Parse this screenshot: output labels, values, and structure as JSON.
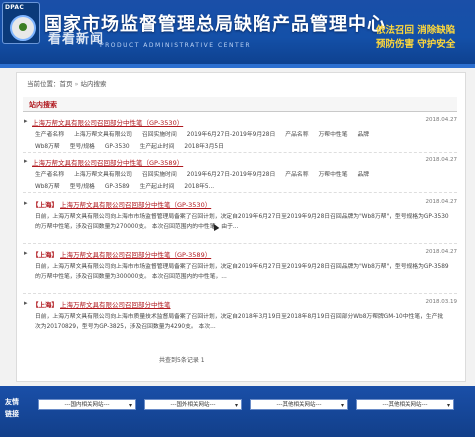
{
  "header": {
    "logo_text": "DPAC",
    "title_cn": "国家市场监督管理总局缺陷产品管理中心",
    "watermark": "看看新闻",
    "title_en": "PRODUCT ADMINISTRATIVE CENTER",
    "slogan_line1": "依法召回 消除缺陷",
    "slogan_line2": "预防伤害 守护安全"
  },
  "breadcrumb": {
    "prefix": "当前位置：",
    "home": "首页",
    "sep": "»",
    "current": "站内搜索"
  },
  "section": {
    "title": "站内搜索"
  },
  "results": [
    {
      "title": "上海万帮文具有限公司召回部分中性笔（GP-3530）",
      "date": "2018.04.27",
      "rows": [
        [
          "生产者名称",
          "上海万帮文具有限公司",
          "召回实施时间",
          "2019年6月27日-2019年9月28日",
          "产品名称",
          "万帮中性笔",
          "品牌"
        ],
        [
          "Wb8万帮",
          "型号/规格",
          "GP-3530",
          "生产起止时间",
          "2018年3月5日"
        ]
      ]
    },
    {
      "title": "上海万帮文具有限公司召回部分中性笔（GP-3589）",
      "date": "2018.04.27",
      "rows": [
        [
          "生产者名称",
          "上海万帮文具有限公司",
          "召回实施时间",
          "2019年6月27日-2019年9月28日",
          "产品名称",
          "万帮中性笔",
          "品牌"
        ],
        [
          "Wb8万帮",
          "型号/规格",
          "GP-3589",
          "生产起止时间",
          "2018年5..."
        ]
      ]
    },
    {
      "tag": "【上海】",
      "title": "上海万帮文具有限公司召回部分中性笔（GP-3530）",
      "date": "2018.04.27",
      "summary": "日前，上海万帮文具有限公司向上海市市场监督管理局备案了召回计划，决定自2019年6月27日至2019年9月28日召回品牌为\"Wb8万帮\"，型号规格为GP-3530的万帮中性笔，涉及召回数量为270000支。  本次召回范围内的中性笔，由于..."
    },
    {
      "tag": "【上海】",
      "title": "上海万帮文具有限公司召回部分中性笔（GP-3589）",
      "date": "2018.04.27",
      "summary": "日前，上海万帮文具有限公司向上海市市场监督管理局备案了召回计划，决定自2019年6月27日至2019年9月28日召回品牌为\"Wb8万帮\"，型号规格为GP-3589的万帮中性笔，涉及召回数量为300000支。  本次召回范围内的中性笔，..."
    },
    {
      "tag": "【上海】",
      "title": "上海万帮文具有限公司召回部分中性笔",
      "date": "2018.03.19",
      "summary": "日前，上海万帮文具有限公司向上海市质量技术监督局备案了召回计划，决定自2018年3月19日至2018年8月19日召回部分Wb8万帮牌GM-10中性笔，生产批次为20170829，型号为GP-3825，涉及召回数量为4290支。  本次..."
    }
  ],
  "counter": "共查到5条记录  1",
  "footer": {
    "friend_label": "友情链接",
    "selects": [
      "---国内相关网站---",
      "---国外相关网站---",
      "---其他相关网站---",
      "---其他相关网站---"
    ]
  }
}
